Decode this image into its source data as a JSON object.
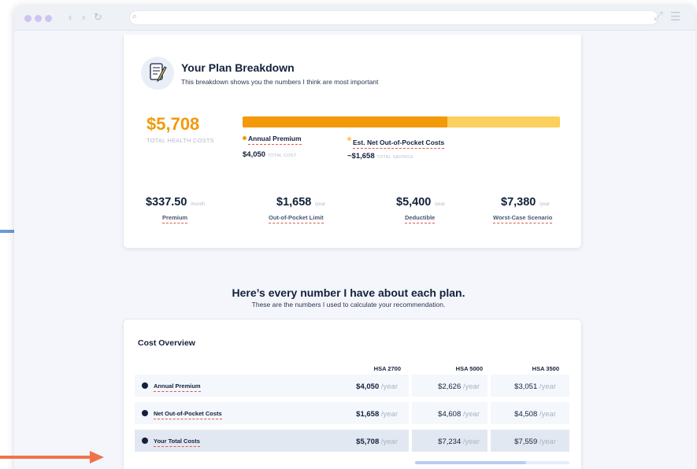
{
  "colors": {
    "accent_orange": "#f29a0a",
    "accent_light_orange": "#fdcf5c",
    "arrow_blue": "#6a9bd8",
    "arrow_orange": "#f0724a",
    "navy": "#13213b"
  },
  "breakdown": {
    "icon": "checklist-pencil-icon",
    "title": "Your Plan Breakdown",
    "subtitle": "This breakdown shows you the numbers I think are most important",
    "total": "$5,708",
    "total_label": "TOTAL HEALTH COSTS",
    "premium_share": 0.645,
    "legend": [
      {
        "label": "Annual Premium",
        "value": "$4,050",
        "value_note": "TOTAL COST"
      },
      {
        "label": "Est. Net Out-of-Pocket Costs",
        "value": "~$1,658",
        "value_note": "TOTAL SAVINGS"
      }
    ],
    "metrics": [
      {
        "value": "$337.50",
        "period": "/month",
        "label": "Premium"
      },
      {
        "value": "$1,658",
        "period": "/year",
        "label": "Out-of-Pocket Limit"
      },
      {
        "value": "$5,400",
        "period": "/year",
        "label": "Deductible"
      },
      {
        "value": "$7,380",
        "period": "/year",
        "label": "Worst-Case Scenario"
      }
    ]
  },
  "section": {
    "title": "Here’s every number I have about each plan.",
    "subtitle": "These are the numbers I used to calculate your recommendation."
  },
  "cost_overview": {
    "title": "Cost Overview",
    "columns": [
      "HSA 2700",
      "HSA 5000",
      "HSA 3500"
    ],
    "rows": [
      {
        "label": "Annual Premium",
        "values": [
          "$4,050",
          "$2,626",
          "$3,051"
        ]
      },
      {
        "label": "Net Out-of-Pocket Costs",
        "values": [
          "$1,658",
          "$4,608",
          "$4,508"
        ]
      },
      {
        "label": "Your Total Costs",
        "values": [
          "$5,708",
          "$7,234",
          "$7,559"
        ]
      }
    ],
    "period": "/year",
    "scroll_position": 0.72
  }
}
